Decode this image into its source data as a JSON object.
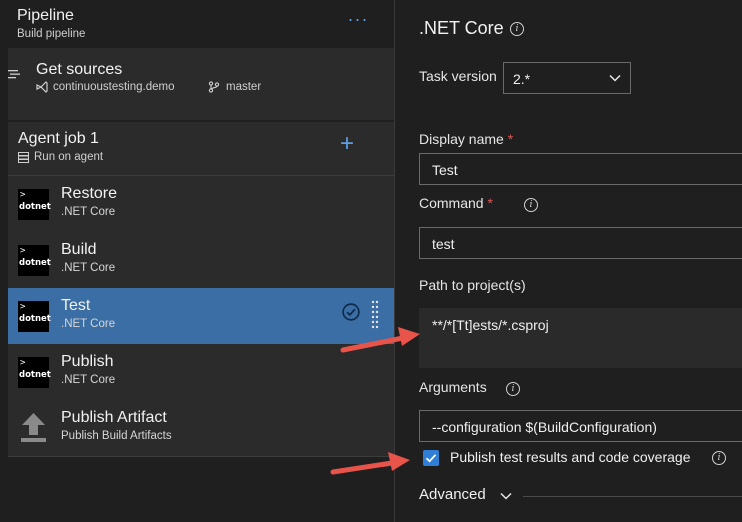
{
  "pipeline": {
    "title": "Pipeline",
    "subtitle": "Build pipeline",
    "more_label": "···"
  },
  "get_sources": {
    "title": "Get sources",
    "repo": "continuoustesting.demo",
    "branch": "master"
  },
  "agent_job": {
    "title": "Agent job 1",
    "subtitle": "Run on agent",
    "add_label": "+"
  },
  "tasks": [
    {
      "title": "Restore",
      "subtitle": ".NET Core",
      "logo": "dotnet"
    },
    {
      "title": "Build",
      "subtitle": ".NET Core",
      "logo": "dotnet"
    },
    {
      "title": "Test",
      "subtitle": ".NET Core",
      "logo": "dotnet",
      "selected": true
    },
    {
      "title": "Publish",
      "subtitle": ".NET Core",
      "logo": "dotnet"
    },
    {
      "title": "Publish Artifact",
      "subtitle": "Publish Build Artifacts",
      "icon": "upload-icon"
    }
  ],
  "logo": {
    "arrow": ">",
    "word": "dotnet"
  },
  "details": {
    "title": ".NET Core",
    "info_glyph": "i",
    "task_version_label": "Task version",
    "task_version_value": "2.*",
    "display_name_label": "Display name",
    "display_name_value": "Test",
    "command_label": "Command",
    "command_value": "test",
    "path_label": "Path to project(s)",
    "path_value": "**/*[Tt]ests/*.csproj",
    "arguments_label": "Arguments",
    "arguments_value": "--configuration $(BuildConfiguration)",
    "publish_checkbox_label": "Publish test results and code coverage",
    "publish_checked": true,
    "required_mark": "*",
    "advanced_label": "Advanced"
  },
  "colors": {
    "background": "#1f1f1f",
    "panel": "#2b2b2b",
    "selected": "#3a6ea5",
    "accent": "#5aa0e6",
    "required": "#e05656",
    "annotation_arrow": "#e8534a",
    "checkbox": "#2f7fd6"
  }
}
